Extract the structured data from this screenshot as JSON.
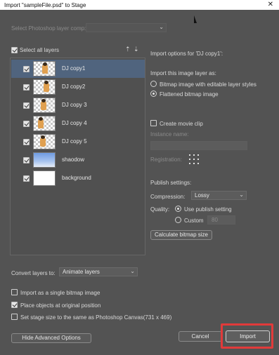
{
  "window": {
    "title": "Import \"sampleFile.psd\" to Stage",
    "close_glyph": "✕"
  },
  "layer_comp": {
    "label": "Select Photoshop layer comp:",
    "value": ""
  },
  "layers": {
    "select_all_label": "Select all layers",
    "items": [
      {
        "name": "DJ copy1",
        "thumb": "figure"
      },
      {
        "name": "DJ copy2",
        "thumb": "figure"
      },
      {
        "name": "DJ copy 3",
        "thumb": "figure"
      },
      {
        "name": "DJ copy 4",
        "thumb": "figure"
      },
      {
        "name": "DJ copy 5",
        "thumb": "figure"
      },
      {
        "name": "shaodow",
        "thumb": "sky"
      },
      {
        "name": "background",
        "thumb": "white"
      }
    ]
  },
  "options": {
    "header": "Import options for 'DJ copy1':",
    "import_as_label": "Import this image layer as:",
    "radio_editable": "Bitmap image with editable layer styles",
    "radio_flattened": "Flattened bitmap image",
    "create_movie_clip": "Create movie clip",
    "instance_name_label": "Instance name:",
    "registration_label": "Registration:",
    "publish_settings_label": "Publish settings:",
    "compression_label": "Compression:",
    "compression_value": "Lossy",
    "quality_label": "Quality:",
    "quality_publish": "Use publish setting",
    "quality_custom": "Custom",
    "custom_value": "80",
    "calc_button": "Calculate bitmap size"
  },
  "convert": {
    "label": "Convert layers to:",
    "value": "Animate layers"
  },
  "bottom_checks": {
    "single_bitmap": "Import as a single bitmap image",
    "original_position": "Place objects at original position",
    "stage_size": "Set stage size to the same as Photoshop Canvas(731 x 469)"
  },
  "buttons": {
    "hide_advanced": "Hide Advanced Options",
    "cancel": "Cancel",
    "import": "Import"
  },
  "colors": {
    "dialog_bg": "#535353",
    "selection": "#50647e",
    "highlight": "#e23a3a"
  }
}
